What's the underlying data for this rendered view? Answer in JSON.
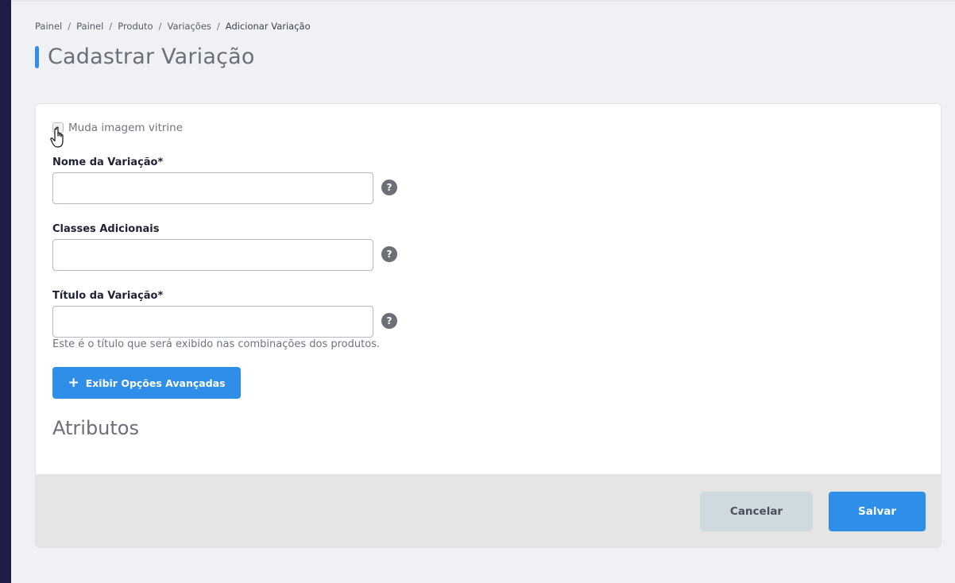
{
  "breadcrumb": {
    "items": [
      "Painel",
      "Painel",
      "Produto",
      "Variações",
      "Adicionar Variação"
    ],
    "separator": "/"
  },
  "page": {
    "title": "Cadastrar Variação"
  },
  "form": {
    "checkbox_label": "Muda imagem vitrine",
    "fields": [
      {
        "label": "Nome da Variação*",
        "value": "",
        "help": "?"
      },
      {
        "label": "Classes Adicionais",
        "value": "",
        "help": "?"
      },
      {
        "label": "Título da Variação*",
        "value": "",
        "help": "?"
      }
    ],
    "title_hint": "Este é o título que será exibido nas combinações dos produtos.",
    "advanced_button": {
      "icon": "+",
      "label": "Exibir Opções Avançadas"
    },
    "attributes_title": "Atributos"
  },
  "footer": {
    "cancel_label": "Cancelar",
    "save_label": "Salvar"
  },
  "colors": {
    "accent": "#2f8fe8",
    "sidebar": "#1f1d45",
    "cancel_bg": "#cfd9e0",
    "footer_bg": "#e5e5e5"
  }
}
